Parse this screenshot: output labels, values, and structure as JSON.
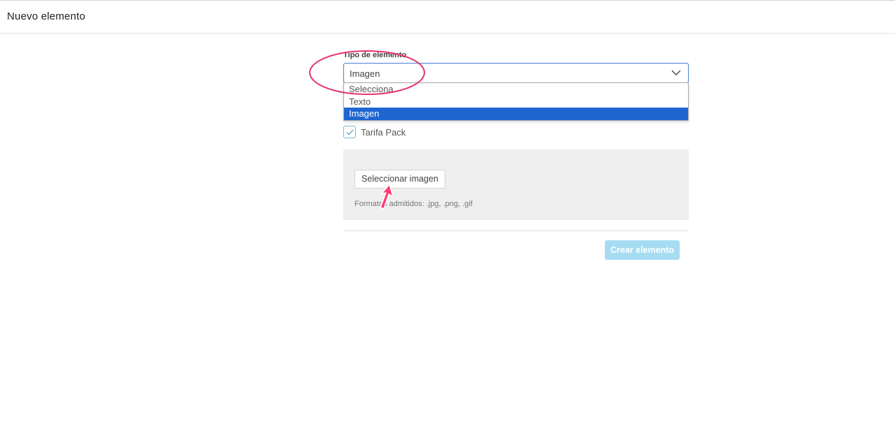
{
  "header": {
    "title": "Nuevo elemento"
  },
  "form": {
    "type_field": {
      "label": "Tipo de elemento",
      "value": "Imagen",
      "options": [
        "Selecciona",
        "Texto",
        "Imagen"
      ],
      "selected_index": 2
    },
    "tarifa_pack": {
      "label": "Tarifa Pack",
      "checked": true
    },
    "upload": {
      "button_label": "Seleccionar imagen",
      "formats_text": "Formatos admitidos: .jpg, .png, .gif"
    },
    "submit": {
      "label": "Crear elemento"
    }
  },
  "colors": {
    "accent": "#1f66d1",
    "select_border": "#4a7fd4",
    "disabled_button": "#a6dcf1",
    "annotation": "#e5336b"
  },
  "icons": {
    "select_chevron": "chevron-down-icon",
    "checkbox_mark": "check-icon"
  }
}
